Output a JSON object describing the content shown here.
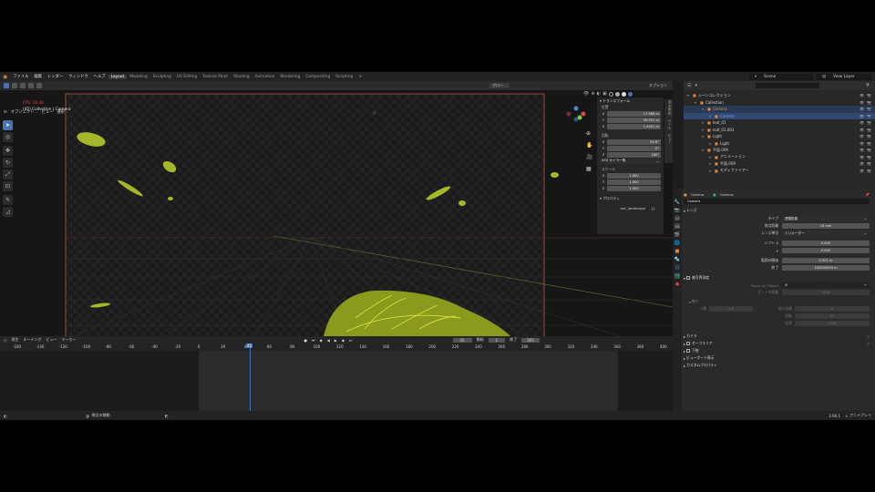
{
  "menu": {
    "items": [
      "ファイル",
      "編集",
      "レンダー",
      "ウィンドウ",
      "ヘルプ"
    ],
    "workspaces": [
      "Layout",
      "Modeling",
      "Sculpting",
      "UV Editing",
      "Texture Paint",
      "Shading",
      "Animation",
      "Rendering",
      "Compositing",
      "Scripting"
    ],
    "active_workspace": "Layout",
    "scene": "Scene",
    "view_layer": "View Layer"
  },
  "header": {
    "mode": "オブジェクト...",
    "menus": [
      "ビュー",
      "選択",
      "追加",
      "オブジェクト"
    ],
    "transform": "グロー...",
    "options": "オプション"
  },
  "viewport": {
    "fps": "FPS: 10.48",
    "collection": "(45) Collection | Camera"
  },
  "npanel": {
    "section": "トランスフォーム",
    "location_label": "位置",
    "location": [
      {
        "axis": "X",
        "value": "17.968 m"
      },
      {
        "axis": "Y",
        "value": "30.091 m"
      },
      {
        "axis": "Z",
        "value": "1.4401 m"
      }
    ],
    "rotation_label": "回転",
    "rotation": [
      {
        "axis": "X",
        "value": "90.6°"
      },
      {
        "axis": "Y",
        "value": "0°"
      },
      {
        "axis": "Z",
        "value": "180°"
      }
    ],
    "rotation_mode": "XYZ オイラー角",
    "scale_label": "スケール",
    "scale": [
      {
        "axis": "X",
        "value": "1.000"
      },
      {
        "axis": "Y",
        "value": "1.000"
      },
      {
        "axis": "Z",
        "value": "1.000"
      }
    ],
    "properties_section": "プロパティ",
    "prop_name": "ant_landscape",
    "prop_value": "{}",
    "tabs": [
      "アイテム",
      "ツール",
      "ビュー"
    ]
  },
  "outliner": {
    "search": "",
    "rows": [
      {
        "label": "シーンコレクション",
        "indent": 0,
        "color": "#d6d6d6"
      },
      {
        "label": "Collection",
        "indent": 1,
        "color": "#d6d6d6"
      },
      {
        "label": "Camera",
        "indent": 2,
        "color": "#e09a3c"
      },
      {
        "label": "Camera",
        "indent": 3,
        "color": "#6fa3ff"
      },
      {
        "label": "leaf_01",
        "indent": 2,
        "color": "#d6d6d6"
      },
      {
        "label": "leaf_01.001",
        "indent": 2,
        "color": "#d6d6d6"
      },
      {
        "label": "Light",
        "indent": 2,
        "color": "#d6d6d6"
      },
      {
        "label": "Light",
        "indent": 3,
        "color": "#d6d6d6"
      },
      {
        "label": "平面.009",
        "indent": 2,
        "color": "#d6d6d6"
      },
      {
        "label": "アニメーション",
        "indent": 3,
        "color": "#d6d6d6"
      },
      {
        "label": "平面.009",
        "indent": 3,
        "color": "#d6d6d6"
      },
      {
        "label": "モディファイアー",
        "indent": 3,
        "color": "#d6d6d6"
      }
    ]
  },
  "properties": {
    "breadcrumb": [
      "Camera",
      "Camera"
    ],
    "data_name": "Camera",
    "lens_section": "レンズ",
    "type_label": "タイプ",
    "type_value": "透視投影",
    "focal_label": "焦点距離",
    "focal_value": "18 mm",
    "lens_unit_label": "レンズ単位",
    "lens_unit_value": "ミリメーター",
    "shift_label": "シフト X",
    "shift_x": "0.000",
    "shift_y_label": "Y",
    "shift_y": "0.000",
    "clip_start_label": "範囲の開始",
    "clip_start": "0.001 m",
    "clip_end_label": "終了",
    "clip_end": "100000000 m",
    "dof_section": "被写界深度",
    "focus_object_label": "Focus on Object",
    "focus_distance_label": "ピントの距離",
    "focus_distance": "10 m",
    "aperture_label": "絞り",
    "fstop_label": "F値",
    "fstop": "2.8",
    "blades_label": "絞り羽根",
    "blades": "0",
    "rotation_label": "回転",
    "rotation": "0°",
    "ratio_label": "比率",
    "ratio": "1.000",
    "collapsed": [
      "カメラ",
      "セーフエリア",
      "下絵",
      "ビューポート表示",
      "カスタムプロパティ"
    ]
  },
  "timeline": {
    "menus": [
      "再生",
      "キーイング",
      "ビュー",
      "マーカー"
    ],
    "current_frame": "45",
    "start_label": "開始",
    "start": "1",
    "end_label": "終了",
    "end": "365",
    "ticks": [
      "-160",
      "-140",
      "-120",
      "-100",
      "-80",
      "-60",
      "-40",
      "-20",
      "0",
      "20",
      "40",
      "60",
      "80",
      "100",
      "120",
      "140",
      "160",
      "180",
      "200",
      "220",
      "240",
      "260",
      "280",
      "300",
      "320",
      "340",
      "360",
      "380",
      "400"
    ]
  },
  "status": {
    "left": "視点の移動",
    "version": "2.90.1",
    "right": "アニメプレイ"
  },
  "colors": {
    "accent": "#4772b3",
    "leaf": "#a6b82a",
    "selection": "#e09a3c"
  }
}
